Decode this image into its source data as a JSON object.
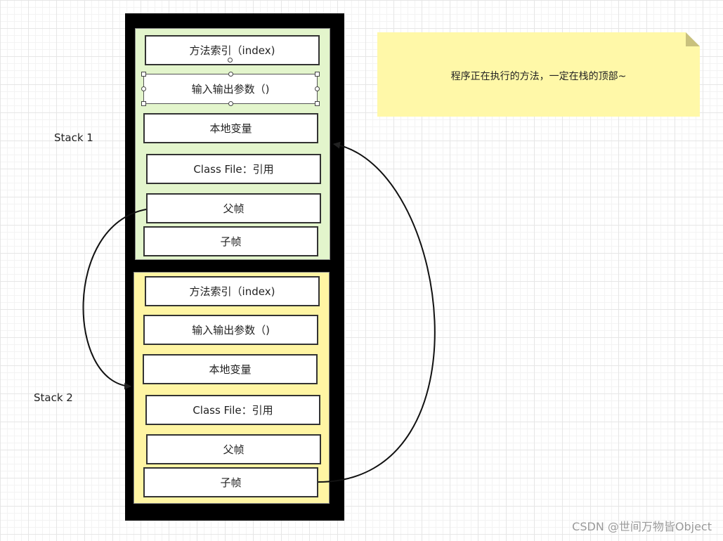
{
  "stacks": [
    {
      "label": "Stack 1",
      "frames": [
        "方法索引（index)",
        "输入输出参数（)",
        "本地变量",
        "Class File：引用",
        "父帧",
        "子帧"
      ]
    },
    {
      "label": "Stack 2",
      "frames": [
        "方法索引（index)",
        "输入输出参数（)",
        "本地变量",
        "Class File：引用",
        "父帧",
        "子帧"
      ]
    }
  ],
  "note": {
    "text": "程序正在执行的方法，一定在栈的顶部~"
  },
  "watermark": "CSDN @世间万物皆Object",
  "colors": {
    "stack1_fill": "#e3f5cc",
    "stack2_fill": "#fff5a3",
    "note_fill": "#fff8a8",
    "frame_border": "#000000"
  }
}
